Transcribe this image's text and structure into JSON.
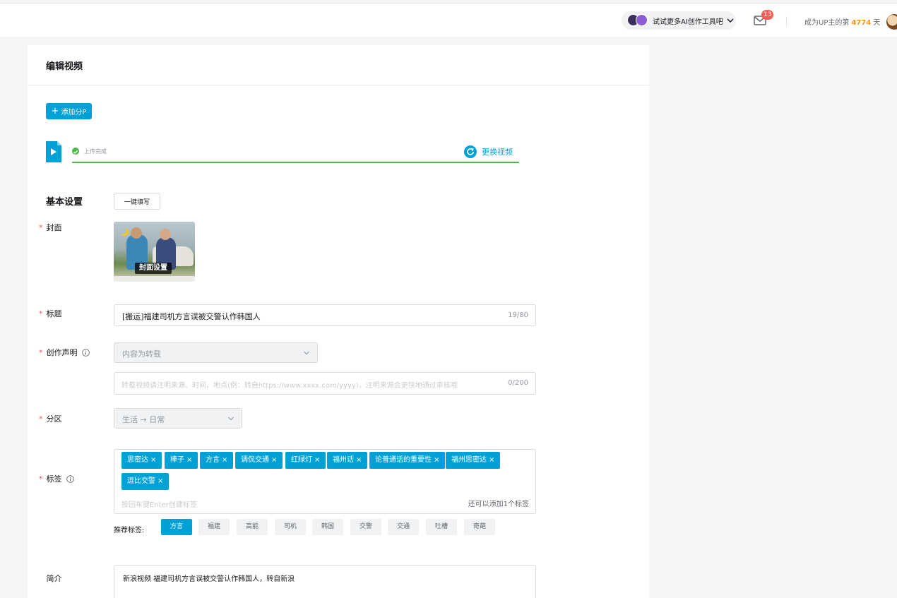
{
  "topbar": {
    "ai_pill_label": "试试更多AI创作工具吧",
    "mail_badge": "13",
    "up_prefix": "成为UP主的第",
    "up_days": "4774",
    "up_suffix": "天"
  },
  "card": {
    "title": "编辑视频",
    "add_part_label": "添加分P",
    "upload_status": "上传完成",
    "replace_label": "更换视频"
  },
  "basic": {
    "section_title": "基本设置",
    "autofill_label": "一键填写",
    "cover_label": "封面",
    "cover_button": "封面设置",
    "title_label": "标题",
    "title_value": "[搬运]福建司机方言误被交警认作韩国人",
    "title_counter": "19/80",
    "declaration_label": "创作声明",
    "declaration_value": "内容为转载",
    "source_placeholder": "转载视频请注明来源、时间、地点(例：转自https://www.xxxx.com/yyyy)，注明来源会更快地通过审核哦",
    "source_counter": "0/200",
    "zone_label": "分区",
    "zone_value": "生活 → 日常",
    "tags_label": "标签",
    "tags": [
      "思密达",
      "棒子",
      "方言",
      "调侃交通",
      "红绿灯",
      "福州话",
      "论普通话的重要性",
      "福州思密达",
      "逗比交警"
    ],
    "tags_hint": "按回车键Enter创建标签",
    "tags_remain": "还可以添加1个标签",
    "rec_label": "推荐标签:",
    "rec_tags": [
      "方言",
      "福建",
      "高能",
      "司机",
      "韩国",
      "交警",
      "交通",
      "吐槽",
      "奇葩"
    ],
    "desc_label": "简介",
    "desc_value": "新浪视频 福建司机方言误被交警认作韩国人，转自新浪"
  },
  "colors": {
    "accent": "#00a1d6",
    "success": "#4cb844",
    "required": "#f85a54",
    "days_highlight": "#ff9212"
  },
  "icons": [
    "ai-avatar-icon",
    "chevron-down-icon",
    "mail-icon",
    "plus-icon",
    "video-file-icon",
    "check-circle-icon",
    "refresh-icon",
    "info-icon",
    "close-icon"
  ]
}
